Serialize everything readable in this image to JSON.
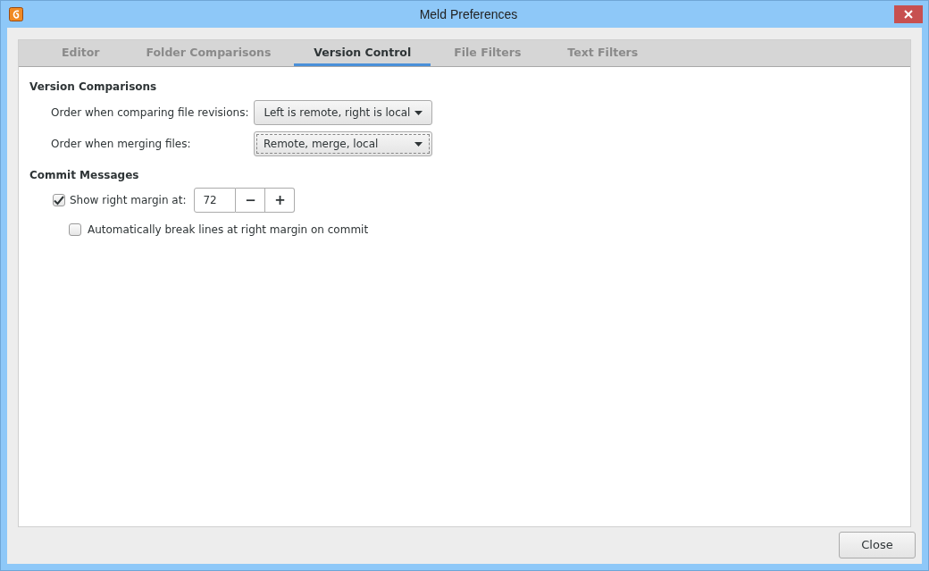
{
  "window": {
    "title": "Meld Preferences"
  },
  "tabs": [
    {
      "label": "Editor",
      "selected": false
    },
    {
      "label": "Folder Comparisons",
      "selected": false
    },
    {
      "label": "Version Control",
      "selected": true
    },
    {
      "label": "File Filters",
      "selected": false
    },
    {
      "label": "Text Filters",
      "selected": false
    }
  ],
  "version_comparisons": {
    "heading": "Version Comparisons",
    "rows": [
      {
        "label": "Order when comparing file revisions:",
        "value": "Left is remote, right is local",
        "focused": false
      },
      {
        "label": "Order when merging files:",
        "value": "Remote, merge, local",
        "focused": true
      }
    ]
  },
  "commit_messages": {
    "heading": "Commit Messages",
    "show_margin": {
      "label": "Show right margin at:",
      "checked": true,
      "value": "72",
      "decrement": "−",
      "increment": "+"
    },
    "auto_break": {
      "label": "Automatically break lines at right margin on commit",
      "checked": false
    }
  },
  "buttons": [
    "Close"
  ]
}
